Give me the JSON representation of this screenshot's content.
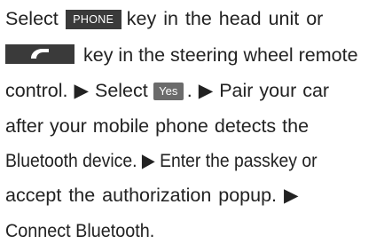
{
  "lines": {
    "l1_a": "Select",
    "l1_key": "PHONE",
    "l1_b": "key in the head unit or",
    "l2_b": "key in the steering wheel remote",
    "l3_a": "control. ▶ Select",
    "l3_btn": "Yes",
    "l3_b": ". ▶ Pair your car",
    "l4": "after your mobile phone detects the",
    "l5": "Bluetooth device. ▶ Enter the passkey or",
    "l6": "accept the authorization popup. ▶",
    "l7": "Connect Bluetooth."
  },
  "icons": {
    "call_key": "phone-handset-icon"
  },
  "colors": {
    "key_bg": "#3a3a3a",
    "button_bg": "#6b6b6b",
    "text": "#222222"
  }
}
